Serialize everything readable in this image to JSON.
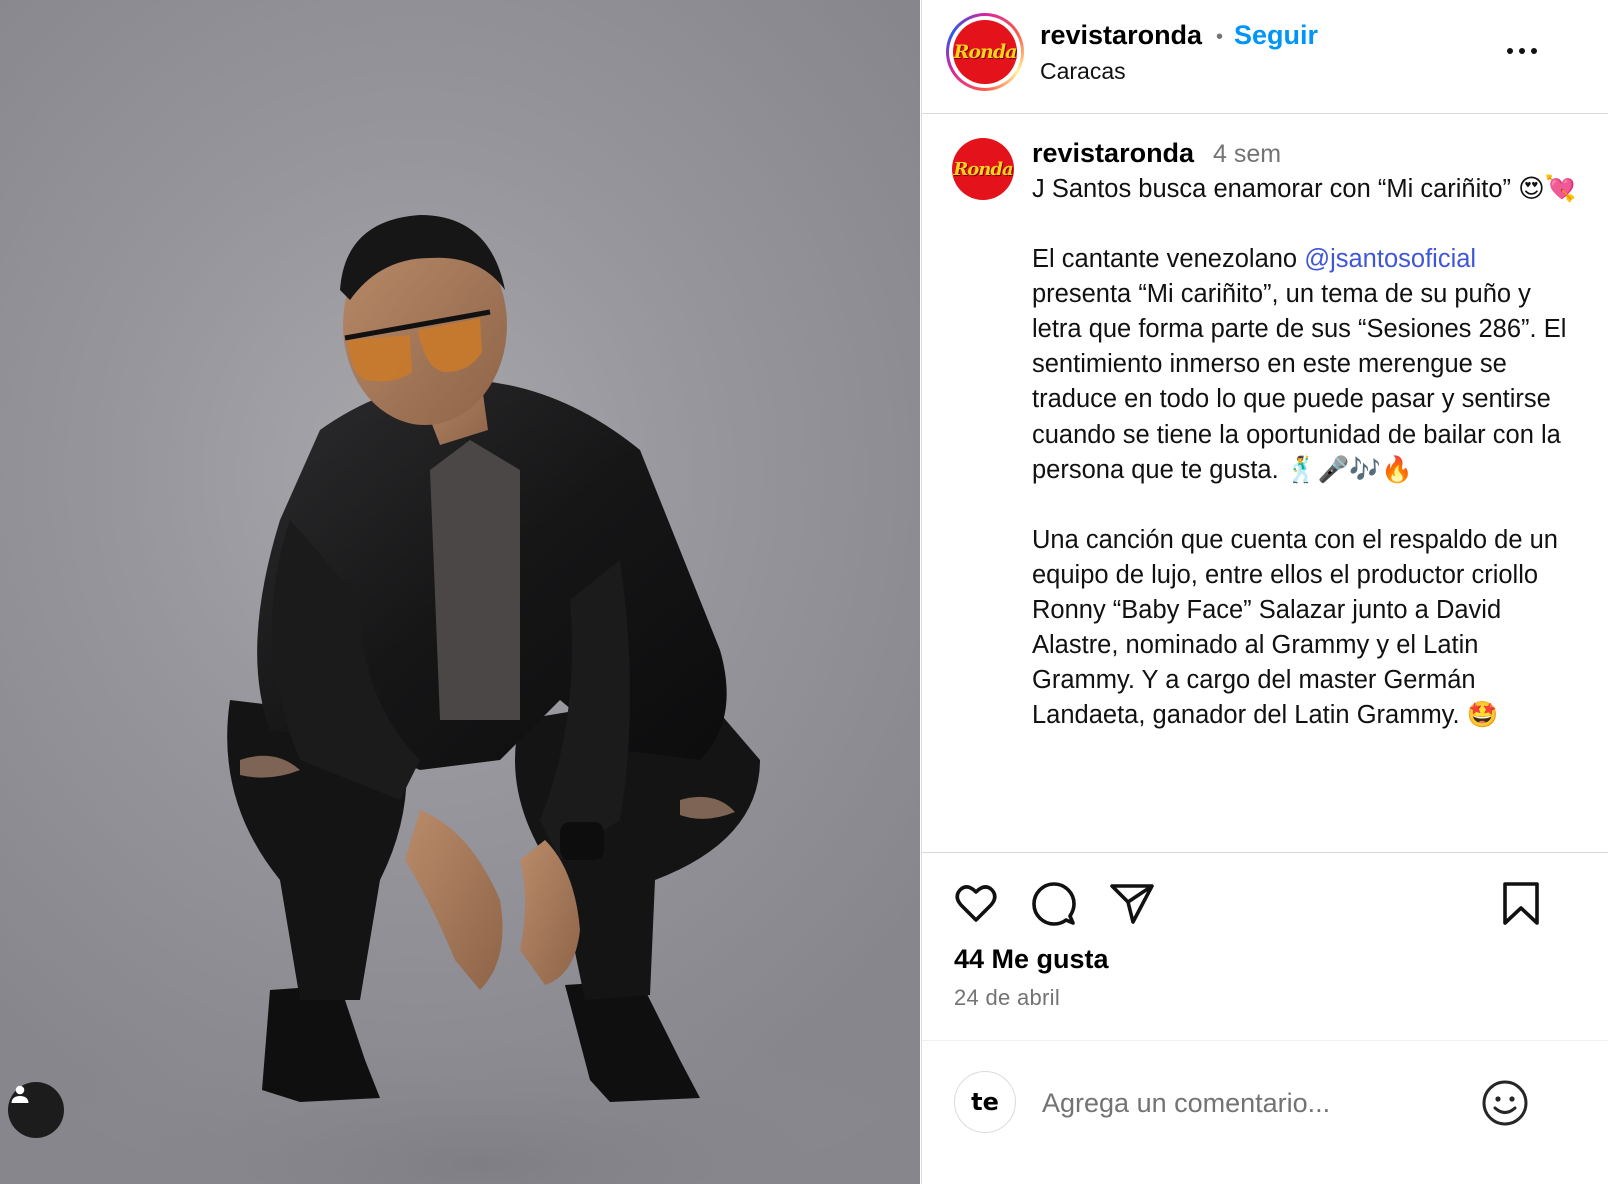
{
  "post": {
    "username": "revistaronda",
    "follow_label": "Seguir",
    "location": "Caracas",
    "logo_text": "Ronda",
    "time_ago": "4 sem",
    "caption": {
      "p1": "J Santos busca enamorar con “Mi cariñito” 😍💘",
      "p2_before": "El cantante venezolano ",
      "p2_mention": "@jsantosoficial",
      "p2_after": " presenta “Mi cariñito”, un tema de su puño y letra que forma parte de sus “Sesiones 286”. El sentimiento inmerso en este merengue se traduce en todo lo que puede pasar y sentirse cuando se tiene la oportunidad de bailar con la persona que te gusta. 🕺🎤🎶🔥",
      "p3": "Una canción que cuenta con el respaldo de un equipo de lujo, entre ellos el productor criollo Ronny “Baby Face” Salazar junto a David Alastre, nominado al Grammy y el Latin Grammy. Y a cargo del master Germán Landaeta, ganador del Latin Grammy. 🤩"
    },
    "likes_label": "44 Me gusta",
    "date_label": "24 de abril",
    "comment_placeholder": "Agrega un comentario...",
    "commenter_avatar_text": "te",
    "colors": {
      "accent": "#0095f6",
      "mention": "#4056d6",
      "muted": "#737373",
      "logo_red": "#e3121b",
      "logo_yellow": "#ffd21e"
    },
    "icons": [
      "user-tag-icon",
      "more-options-icon",
      "heart-icon",
      "comment-icon",
      "share-icon",
      "bookmark-icon",
      "emoji-icon"
    ]
  }
}
